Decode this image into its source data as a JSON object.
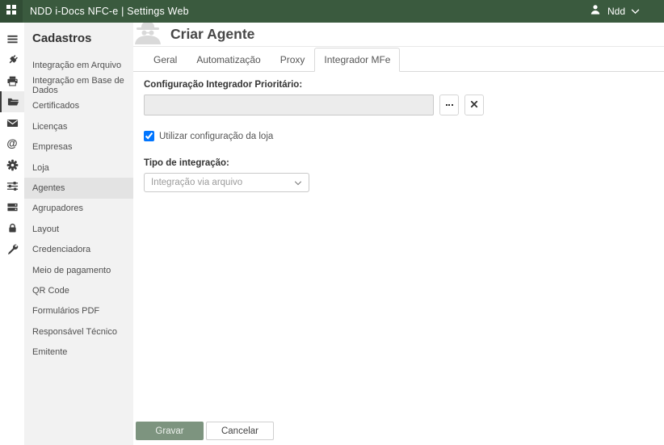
{
  "topbar": {
    "title": "NDD i-Docs NFC-e | Settings Web",
    "user_name": "Ndd"
  },
  "icons": {
    "at_glyph": "@",
    "rail": [
      "menu-icon",
      "plug-icon",
      "printer-icon",
      "folder-open-icon",
      "mail-icon",
      "at-icon",
      "gear-icon",
      "sliders-icon",
      "server-icon",
      "lock-icon",
      "wrench-icon"
    ],
    "header_icon": "spy-agent-icon"
  },
  "sidebar": {
    "header": "Cadastros",
    "items": [
      {
        "label": "Integração em Arquivo",
        "active": false
      },
      {
        "label": "Integração em Base de Dados",
        "active": false
      },
      {
        "label": "Certificados",
        "active": false
      },
      {
        "label": "Licenças",
        "active": false
      },
      {
        "label": "Empresas",
        "active": false
      },
      {
        "label": "Loja",
        "active": false
      },
      {
        "label": "Agentes",
        "active": true
      },
      {
        "label": "Agrupadores",
        "active": false
      },
      {
        "label": "Layout",
        "active": false
      },
      {
        "label": "Credenciadora",
        "active": false
      },
      {
        "label": "Meio de pagamento",
        "active": false
      },
      {
        "label": "QR Code",
        "active": false
      },
      {
        "label": "Formulários PDF",
        "active": false
      },
      {
        "label": "Responsável Técnico",
        "active": false
      },
      {
        "label": "Emitente",
        "active": false
      }
    ]
  },
  "main": {
    "page_title": "Criar Agente",
    "tabs": [
      {
        "label": "Geral",
        "active": false
      },
      {
        "label": "Automatização",
        "active": false
      },
      {
        "label": "Proxy",
        "active": false
      },
      {
        "label": "Integrador MFe",
        "active": true
      }
    ],
    "form": {
      "config_label": "Configuração Integrador Prioritário:",
      "config_value": "",
      "checkbox_label": "Utilizar configuração da loja",
      "checkbox_checked": true,
      "tipo_label": "Tipo de integração:",
      "tipo_value": "Integração via arquivo"
    },
    "footer": {
      "save_label": "Gravar",
      "cancel_label": "Cancelar"
    }
  },
  "colors": {
    "topbar_green": "#3a5a3e",
    "save_green": "#7d947f",
    "menu_bg": "#f2f2f2",
    "selected_item_bg": "#e3e3e3",
    "active_rail_bg": "#ebebeb"
  }
}
